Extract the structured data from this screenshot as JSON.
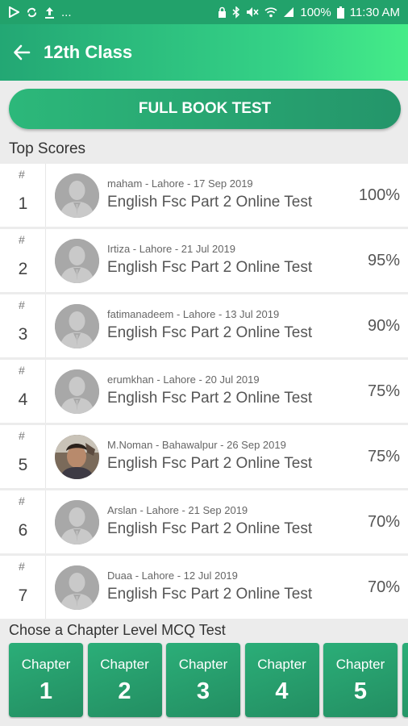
{
  "status_bar": {
    "left_icons": [
      "play-icon",
      "sync-icon",
      "upload-icon"
    ],
    "more": "...",
    "battery_text": "100%",
    "time": "11:30 AM"
  },
  "app_bar": {
    "title": "12th Class"
  },
  "full_book_button": {
    "label": "FULL BOOK TEST"
  },
  "top_scores": {
    "title": "Top Scores",
    "hash": "#",
    "rows": [
      {
        "rank": "1",
        "meta": "maham - Lahore - 17 Sep 2019",
        "test": "English Fsc Part 2 Online Test",
        "score": "100%",
        "avatar": "default"
      },
      {
        "rank": "2",
        "meta": "Irtiza - Lahore - 21 Jul 2019",
        "test": "English Fsc Part 2 Online Test",
        "score": "95%",
        "avatar": "default"
      },
      {
        "rank": "3",
        "meta": "fatimanadeem - Lahore - 13 Jul 2019",
        "test": "English Fsc Part 2 Online Test",
        "score": "90%",
        "avatar": "default"
      },
      {
        "rank": "4",
        "meta": "erumkhan - Lahore - 20 Jul 2019",
        "test": "English Fsc Part 2 Online Test",
        "score": "75%",
        "avatar": "default"
      },
      {
        "rank": "5",
        "meta": "M.Noman - Bahawalpur - 26 Sep 2019",
        "test": "English Fsc Part 2 Online Test",
        "score": "75%",
        "avatar": "photo"
      },
      {
        "rank": "6",
        "meta": "Arslan - Lahore - 21 Sep 2019",
        "test": "English Fsc Part 2 Online Test",
        "score": "70%",
        "avatar": "default"
      },
      {
        "rank": "7",
        "meta": "Duaa - Lahore - 12 Jul 2019",
        "test": "English Fsc Part 2 Online Test",
        "score": "70%",
        "avatar": "default"
      }
    ]
  },
  "chapters": {
    "title": "Chose a Chapter Level MCQ Test",
    "label": "Chapter",
    "items": [
      "1",
      "2",
      "3",
      "4",
      "5",
      ""
    ]
  }
}
